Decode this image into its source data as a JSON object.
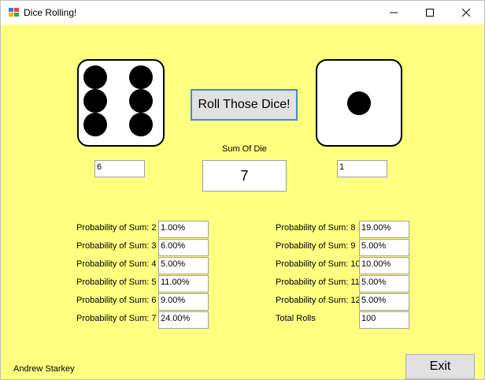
{
  "window": {
    "title": "Dice Rolling!"
  },
  "dice": {
    "left_value": "6",
    "right_value": "1",
    "left_face": 6,
    "right_face": 1
  },
  "roll_button_label": "Roll Those Dice!",
  "sum": {
    "label": "Sum Of Die",
    "value": "7"
  },
  "probabilities_left": [
    {
      "label": "Probability of Sum: 2",
      "value": "1.00%"
    },
    {
      "label": "Probability of Sum: 3",
      "value": "6.00%"
    },
    {
      "label": "Probability of Sum: 4",
      "value": "5.00%"
    },
    {
      "label": "Probability of Sum: 5",
      "value": "11.00%"
    },
    {
      "label": "Probability of Sum: 6",
      "value": "9.00%"
    },
    {
      "label": "Probability of Sum: 7",
      "value": "24.00%"
    }
  ],
  "probabilities_right": [
    {
      "label": "Probability of Sum: 8",
      "value": "19.00%"
    },
    {
      "label": "Probability of Sum: 9",
      "value": "5.00%"
    },
    {
      "label": "Probability of Sum: 10",
      "value": "10.00%"
    },
    {
      "label": "Probability of Sum: 11",
      "value": "5.00%"
    },
    {
      "label": "Probability of Sum: 12",
      "value": "5.00%"
    }
  ],
  "total_rolls": {
    "label": "Total Rolls",
    "value": "100"
  },
  "author": "Andrew Starkey",
  "exit_label": "Exit",
  "colors": {
    "form_background": "#ffff80",
    "button_face": "#e1e1e1",
    "focus_border": "#3c8fd6"
  }
}
